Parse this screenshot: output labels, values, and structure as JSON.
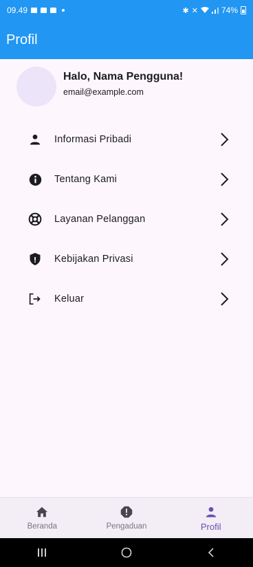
{
  "status_bar": {
    "time": "09.49",
    "battery": "74%"
  },
  "app_bar": {
    "title": "Profil"
  },
  "profile": {
    "name": "Halo, Nama Pengguna!",
    "email": "email@example.com"
  },
  "menu": [
    {
      "label": "Informasi Pribadi",
      "icon": "person-icon"
    },
    {
      "label": "Tentang Kami",
      "icon": "info-icon"
    },
    {
      "label": "Layanan Pelanggan",
      "icon": "support-icon"
    },
    {
      "label": "Kebijakan Privasi",
      "icon": "shield-icon"
    },
    {
      "label": "Keluar",
      "icon": "logout-icon"
    }
  ],
  "bottom_nav": [
    {
      "label": "Beranda",
      "icon": "home-icon",
      "active": false
    },
    {
      "label": "Pengaduan",
      "icon": "report-icon",
      "active": false
    },
    {
      "label": "Profil",
      "icon": "person-icon",
      "active": true
    }
  ],
  "colors": {
    "primary": "#2196f3",
    "active_nav": "#6a4fb0",
    "avatar": "#ece4f8",
    "background": "#fdf7fd"
  }
}
